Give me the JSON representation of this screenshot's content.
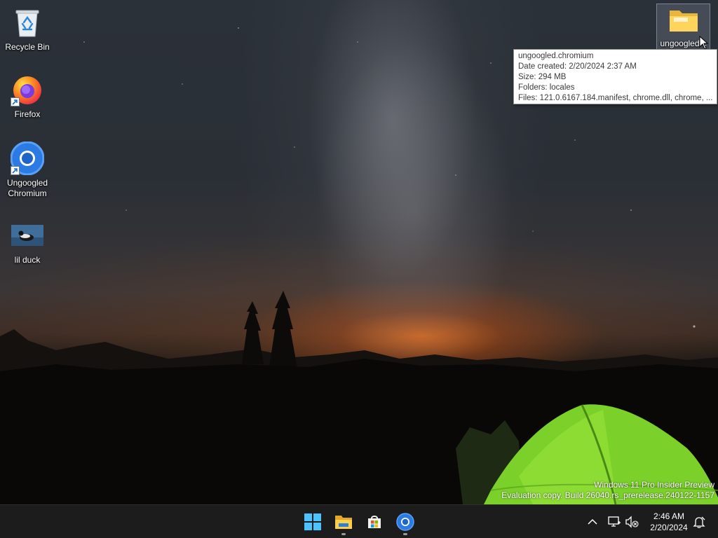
{
  "desktop": {
    "icons": [
      {
        "label": "Recycle Bin"
      },
      {
        "label": "Firefox"
      },
      {
        "label": "Ungoogled Chromium"
      },
      {
        "label": "lil duck"
      },
      {
        "label": "ungoogled-c"
      }
    ]
  },
  "tooltip": {
    "name": "ungoogled.chromium",
    "date_created": "Date created: 2/20/2024 2:37 AM",
    "size": "Size: 294 MB",
    "folders": "Folders: locales",
    "files": "Files: 121.0.6167.184.manifest, chrome.dll, chrome, ..."
  },
  "watermark": {
    "line1": "Windows 11 Pro Insider Preview",
    "line2": "Evaluation copy. Build 26040.rs_prerelease.240122-1157"
  },
  "taskbar": {
    "apps": [
      {
        "icon": "windows-start-icon"
      },
      {
        "icon": "file-explorer-icon"
      },
      {
        "icon": "microsoft-store-icon"
      },
      {
        "icon": "chromium-icon"
      }
    ],
    "tray": {
      "time": "2:46 AM",
      "date": "2/20/2024"
    }
  },
  "colors": {
    "taskbar_bg": "#1c1c1c",
    "tent_green": "#7bd12a",
    "sunset_orange": "#ff7a1e"
  }
}
